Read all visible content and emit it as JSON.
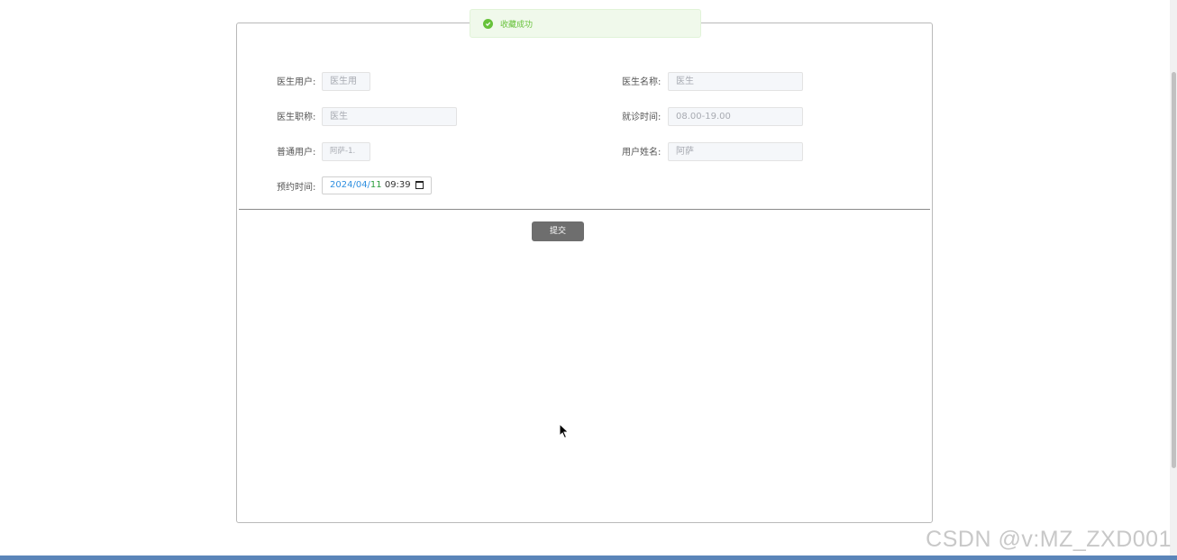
{
  "toast": {
    "text": "收藏成功",
    "icon": "check-circle-icon",
    "color": "#67c23a"
  },
  "form": {
    "doctor_user": {
      "label": "医生用户:",
      "value": "医生用"
    },
    "doctor_name": {
      "label": "医生名称:",
      "value": "医生"
    },
    "doctor_title": {
      "label": "医生职称:",
      "value": "医生"
    },
    "visit_time": {
      "label": "就诊时间:",
      "value": "08.00-19.00"
    },
    "normal_user": {
      "label": "普通用户:",
      "value": "阿萨-1."
    },
    "user_name": {
      "label": "用户姓名:",
      "value": "阿萨"
    },
    "appointment_time": {
      "label": "预约时间:",
      "year": "2024/",
      "month": "04/",
      "day": "11",
      "time": " 09:39",
      "icon": "calendar-icon"
    },
    "submit_label": "提交"
  },
  "watermark": "CSDN @v:MZ_ZXD001",
  "colors": {
    "submit_bg": "#6e6e6e",
    "bottom_bar": "#5b85b9"
  }
}
